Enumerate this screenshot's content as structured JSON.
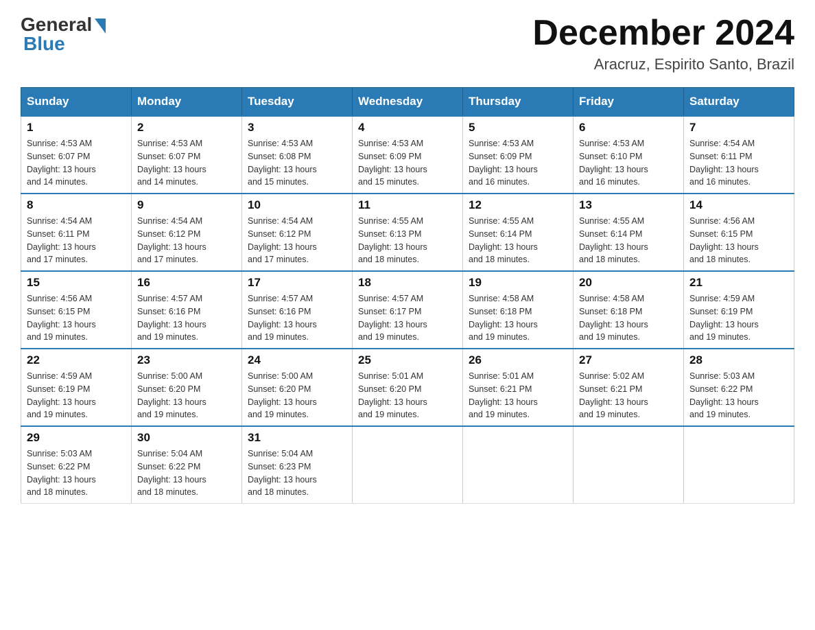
{
  "header": {
    "logo_general": "General",
    "logo_blue": "Blue",
    "month_title": "December 2024",
    "location": "Aracruz, Espirito Santo, Brazil"
  },
  "days_of_week": [
    "Sunday",
    "Monday",
    "Tuesday",
    "Wednesday",
    "Thursday",
    "Friday",
    "Saturday"
  ],
  "weeks": [
    [
      {
        "day": "1",
        "sunrise": "4:53 AM",
        "sunset": "6:07 PM",
        "daylight": "13 hours and 14 minutes."
      },
      {
        "day": "2",
        "sunrise": "4:53 AM",
        "sunset": "6:07 PM",
        "daylight": "13 hours and 14 minutes."
      },
      {
        "day": "3",
        "sunrise": "4:53 AM",
        "sunset": "6:08 PM",
        "daylight": "13 hours and 15 minutes."
      },
      {
        "day": "4",
        "sunrise": "4:53 AM",
        "sunset": "6:09 PM",
        "daylight": "13 hours and 15 minutes."
      },
      {
        "day": "5",
        "sunrise": "4:53 AM",
        "sunset": "6:09 PM",
        "daylight": "13 hours and 16 minutes."
      },
      {
        "day": "6",
        "sunrise": "4:53 AM",
        "sunset": "6:10 PM",
        "daylight": "13 hours and 16 minutes."
      },
      {
        "day": "7",
        "sunrise": "4:54 AM",
        "sunset": "6:11 PM",
        "daylight": "13 hours and 16 minutes."
      }
    ],
    [
      {
        "day": "8",
        "sunrise": "4:54 AM",
        "sunset": "6:11 PM",
        "daylight": "13 hours and 17 minutes."
      },
      {
        "day": "9",
        "sunrise": "4:54 AM",
        "sunset": "6:12 PM",
        "daylight": "13 hours and 17 minutes."
      },
      {
        "day": "10",
        "sunrise": "4:54 AM",
        "sunset": "6:12 PM",
        "daylight": "13 hours and 17 minutes."
      },
      {
        "day": "11",
        "sunrise": "4:55 AM",
        "sunset": "6:13 PM",
        "daylight": "13 hours and 18 minutes."
      },
      {
        "day": "12",
        "sunrise": "4:55 AM",
        "sunset": "6:14 PM",
        "daylight": "13 hours and 18 minutes."
      },
      {
        "day": "13",
        "sunrise": "4:55 AM",
        "sunset": "6:14 PM",
        "daylight": "13 hours and 18 minutes."
      },
      {
        "day": "14",
        "sunrise": "4:56 AM",
        "sunset": "6:15 PM",
        "daylight": "13 hours and 18 minutes."
      }
    ],
    [
      {
        "day": "15",
        "sunrise": "4:56 AM",
        "sunset": "6:15 PM",
        "daylight": "13 hours and 19 minutes."
      },
      {
        "day": "16",
        "sunrise": "4:57 AM",
        "sunset": "6:16 PM",
        "daylight": "13 hours and 19 minutes."
      },
      {
        "day": "17",
        "sunrise": "4:57 AM",
        "sunset": "6:16 PM",
        "daylight": "13 hours and 19 minutes."
      },
      {
        "day": "18",
        "sunrise": "4:57 AM",
        "sunset": "6:17 PM",
        "daylight": "13 hours and 19 minutes."
      },
      {
        "day": "19",
        "sunrise": "4:58 AM",
        "sunset": "6:18 PM",
        "daylight": "13 hours and 19 minutes."
      },
      {
        "day": "20",
        "sunrise": "4:58 AM",
        "sunset": "6:18 PM",
        "daylight": "13 hours and 19 minutes."
      },
      {
        "day": "21",
        "sunrise": "4:59 AM",
        "sunset": "6:19 PM",
        "daylight": "13 hours and 19 minutes."
      }
    ],
    [
      {
        "day": "22",
        "sunrise": "4:59 AM",
        "sunset": "6:19 PM",
        "daylight": "13 hours and 19 minutes."
      },
      {
        "day": "23",
        "sunrise": "5:00 AM",
        "sunset": "6:20 PM",
        "daylight": "13 hours and 19 minutes."
      },
      {
        "day": "24",
        "sunrise": "5:00 AM",
        "sunset": "6:20 PM",
        "daylight": "13 hours and 19 minutes."
      },
      {
        "day": "25",
        "sunrise": "5:01 AM",
        "sunset": "6:20 PM",
        "daylight": "13 hours and 19 minutes."
      },
      {
        "day": "26",
        "sunrise": "5:01 AM",
        "sunset": "6:21 PM",
        "daylight": "13 hours and 19 minutes."
      },
      {
        "day": "27",
        "sunrise": "5:02 AM",
        "sunset": "6:21 PM",
        "daylight": "13 hours and 19 minutes."
      },
      {
        "day": "28",
        "sunrise": "5:03 AM",
        "sunset": "6:22 PM",
        "daylight": "13 hours and 19 minutes."
      }
    ],
    [
      {
        "day": "29",
        "sunrise": "5:03 AM",
        "sunset": "6:22 PM",
        "daylight": "13 hours and 18 minutes."
      },
      {
        "day": "30",
        "sunrise": "5:04 AM",
        "sunset": "6:22 PM",
        "daylight": "13 hours and 18 minutes."
      },
      {
        "day": "31",
        "sunrise": "5:04 AM",
        "sunset": "6:23 PM",
        "daylight": "13 hours and 18 minutes."
      },
      null,
      null,
      null,
      null
    ]
  ],
  "labels": {
    "sunrise_prefix": "Sunrise: ",
    "sunset_prefix": "Sunset: ",
    "daylight_prefix": "Daylight: "
  }
}
